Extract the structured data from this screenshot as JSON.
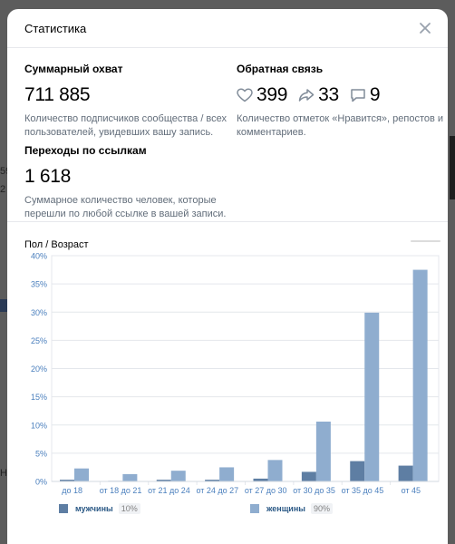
{
  "modal": {
    "title": "Статистика"
  },
  "reach": {
    "heading": "Суммарный охват",
    "value": "711 885",
    "description": "Количество подписчиков сообщества / всех пользователей, увидевших вашу запись."
  },
  "clicks": {
    "heading": "Переходы по ссылкам",
    "value": "1 618",
    "description": "Суммарное количество человек, которые перешли по любой ссылке в вашей записи."
  },
  "feedback": {
    "heading": "Обратная связь",
    "likes": "399",
    "reposts": "33",
    "comments": "9",
    "description": "Количество отметок «Нравится», репостов и комментариев.",
    "icons": [
      "heart-icon",
      "repost-icon",
      "comment-icon"
    ]
  },
  "chart_section": {
    "title": "Пол / Возраст"
  },
  "chart_data": {
    "type": "bar",
    "categories": [
      "до 18",
      "от 18 до 21",
      "от 21 до 24",
      "от 24 до 27",
      "от 27 до 30",
      "от 30 до 35",
      "от 35 до 45",
      "от 45"
    ],
    "series": [
      {
        "name": "мужчины",
        "share": "10%",
        "color": "#5e7ea3",
        "values": [
          0.3,
          0.1,
          0.3,
          0.3,
          0.5,
          1.7,
          3.6,
          2.8
        ]
      },
      {
        "name": "женщины",
        "share": "90%",
        "color": "#8fadcf",
        "values": [
          2.3,
          1.3,
          1.9,
          2.5,
          3.8,
          10.6,
          29.9,
          37.5
        ]
      }
    ],
    "ylim": [
      0,
      40
    ],
    "yticks": [
      "0%",
      "5%",
      "10%",
      "15%",
      "20%",
      "25%",
      "30%",
      "35%",
      "40%"
    ],
    "grid": true,
    "legend": "bottom"
  }
}
